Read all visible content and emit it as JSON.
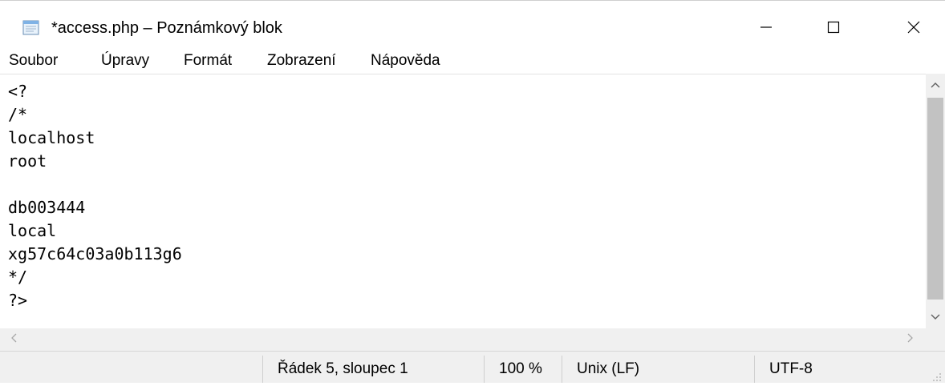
{
  "window": {
    "title": "*access.php – Poznámkový blok"
  },
  "menu": {
    "items": [
      {
        "label": "Soubor"
      },
      {
        "label": "Úpravy"
      },
      {
        "label": "Formát"
      },
      {
        "label": "Zobrazení"
      },
      {
        "label": "Nápověda"
      }
    ]
  },
  "editor": {
    "lines": [
      "<?",
      "/*",
      "localhost",
      "root",
      "",
      "db003444",
      "local",
      "xg57c64c03a0b113g6",
      "*/",
      "?>"
    ]
  },
  "status": {
    "position": "Řádek 5, sloupec 1",
    "zoom": "100 %",
    "line_ending": "Unix (LF)",
    "encoding": "UTF-8"
  },
  "icons": {
    "app": "notepad-icon",
    "minimize": "minimize-icon",
    "maximize": "maximize-icon",
    "close": "close-icon"
  },
  "colors": {
    "chrome_background": "#f0f0f0",
    "scrollbar_thumb": "#c2c2c2",
    "editor_background": "#ffffff"
  }
}
